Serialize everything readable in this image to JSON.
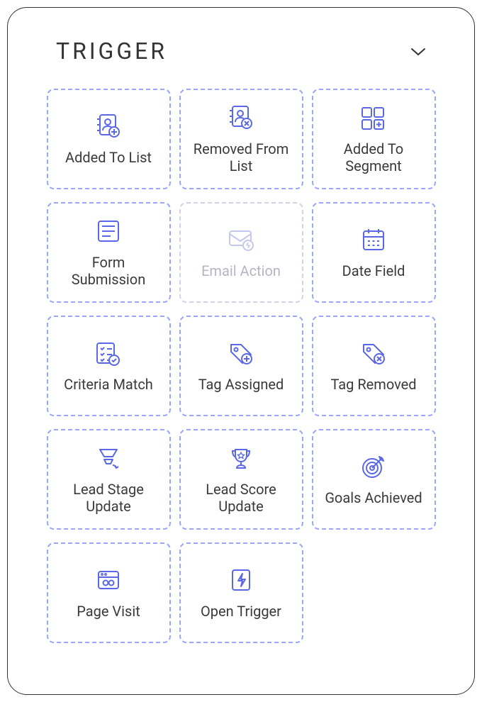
{
  "header": {
    "title": "TRIGGER"
  },
  "cards": [
    {
      "label": "Added To List",
      "icon": "user-add-icon",
      "disabled": false
    },
    {
      "label": "Removed From List",
      "icon": "user-remove-icon",
      "disabled": false
    },
    {
      "label": "Added To Segment",
      "icon": "segment-add-icon",
      "disabled": false
    },
    {
      "label": "Form Submission",
      "icon": "form-icon",
      "disabled": false
    },
    {
      "label": "Email Action",
      "icon": "email-action-icon",
      "disabled": true
    },
    {
      "label": "Date Field",
      "icon": "calendar-icon",
      "disabled": false
    },
    {
      "label": "Criteria Match",
      "icon": "criteria-icon",
      "disabled": false
    },
    {
      "label": "Tag Assigned",
      "icon": "tag-add-icon",
      "disabled": false
    },
    {
      "label": "Tag Removed",
      "icon": "tag-remove-icon",
      "disabled": false
    },
    {
      "label": "Lead Stage Update",
      "icon": "funnel-icon",
      "disabled": false
    },
    {
      "label": "Lead Score Update",
      "icon": "trophy-icon",
      "disabled": false
    },
    {
      "label": "Goals Achieved",
      "icon": "target-icon",
      "disabled": false
    },
    {
      "label": "Page Visit",
      "icon": "browser-icon",
      "disabled": false
    },
    {
      "label": "Open Trigger",
      "icon": "bolt-icon",
      "disabled": false
    }
  ]
}
